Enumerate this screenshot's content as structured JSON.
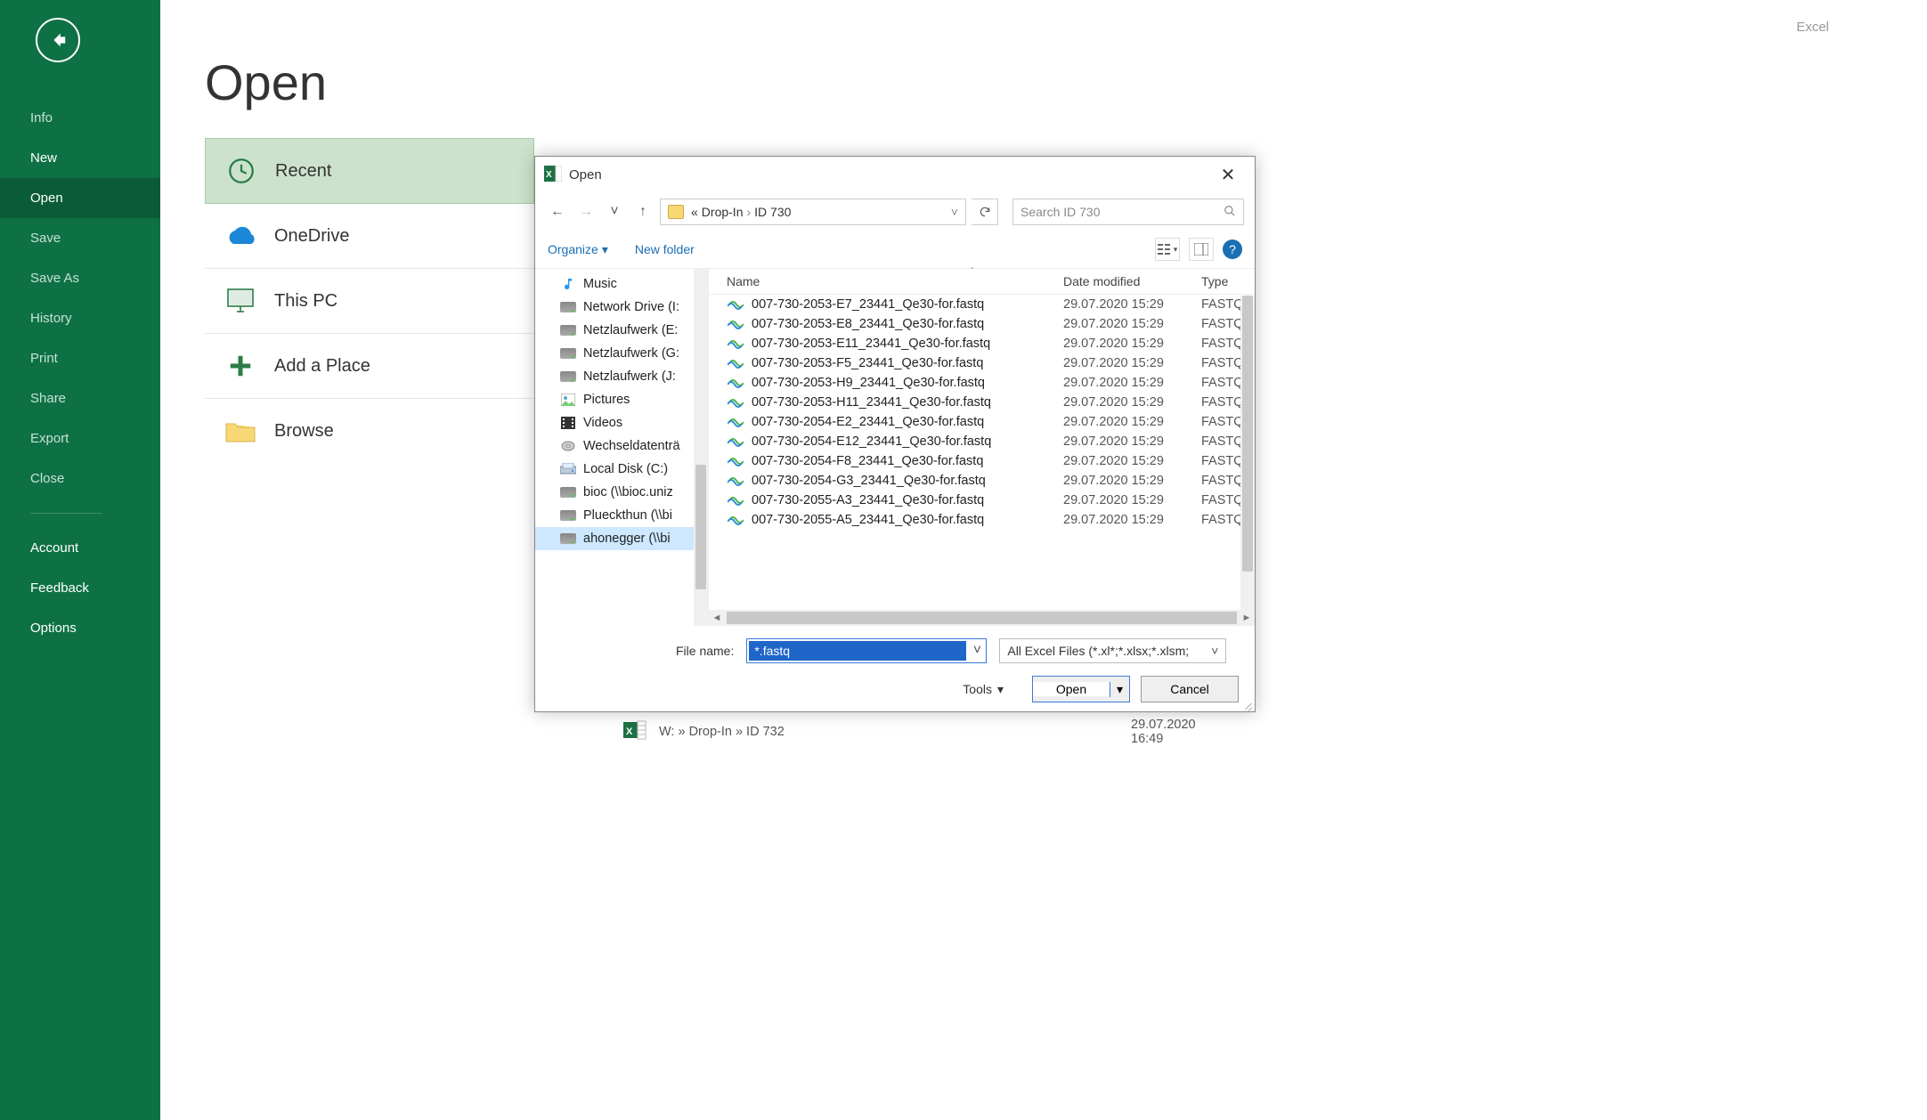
{
  "app_title": "Excel",
  "page_title": "Open",
  "green_nav": {
    "items": [
      {
        "label": "Info",
        "dim": true
      },
      {
        "label": "New",
        "white": true
      },
      {
        "label": "Open",
        "selected": true
      },
      {
        "label": "Save",
        "dim": true
      },
      {
        "label": "Save As",
        "dim": true
      },
      {
        "label": "History",
        "dim": true
      },
      {
        "label": "Print",
        "dim": true
      },
      {
        "label": "Share",
        "dim": true
      },
      {
        "label": "Export",
        "dim": true
      },
      {
        "label": "Close",
        "dim": true
      }
    ],
    "bottom": [
      {
        "label": "Account"
      },
      {
        "label": "Feedback"
      },
      {
        "label": "Options"
      }
    ]
  },
  "places": [
    {
      "label": "Recent",
      "icon": "clock",
      "selected": true
    },
    {
      "label": "OneDrive",
      "icon": "cloud"
    },
    {
      "label": "This PC",
      "icon": "monitor"
    },
    {
      "label": "Add a Place",
      "icon": "plus"
    },
    {
      "label": "Browse",
      "icon": "folder"
    }
  ],
  "dialog": {
    "title": "Open",
    "breadcrumb_prefix": "«",
    "breadcrumbs": [
      "Drop-In",
      "ID 730"
    ],
    "search_placeholder": "Search ID 730",
    "toolbar": {
      "organize": "Organize",
      "newfolder": "New folder"
    },
    "tree": [
      {
        "label": "Music",
        "icon": "music"
      },
      {
        "label": "Network Drive (I:",
        "icon": "drive"
      },
      {
        "label": "Netzlaufwerk (E:",
        "icon": "drive"
      },
      {
        "label": "Netzlaufwerk (G:",
        "icon": "drive"
      },
      {
        "label": "Netzlaufwerk (J:",
        "icon": "drive"
      },
      {
        "label": "Pictures",
        "icon": "picture"
      },
      {
        "label": "Videos",
        "icon": "video"
      },
      {
        "label": "Wechseldatenträ",
        "icon": "disk"
      },
      {
        "label": "Local Disk (C:)",
        "icon": "localdisk"
      },
      {
        "label": "bioc (\\\\bioc.uniz",
        "icon": "drive"
      },
      {
        "label": "Plueckthun (\\\\bi",
        "icon": "drive"
      },
      {
        "label": "ahonegger (\\\\bi",
        "icon": "drive",
        "selected": true
      }
    ],
    "columns": {
      "name": "Name",
      "date": "Date modified",
      "type": "Type"
    },
    "files": [
      {
        "name": "007-730-2053-E7_23441_Qe30-for.fastq",
        "date": "29.07.2020 15:29",
        "type": "FASTQ"
      },
      {
        "name": "007-730-2053-E8_23441_Qe30-for.fastq",
        "date": "29.07.2020 15:29",
        "type": "FASTQ"
      },
      {
        "name": "007-730-2053-E11_23441_Qe30-for.fastq",
        "date": "29.07.2020 15:29",
        "type": "FASTQ"
      },
      {
        "name": "007-730-2053-F5_23441_Qe30-for.fastq",
        "date": "29.07.2020 15:29",
        "type": "FASTQ"
      },
      {
        "name": "007-730-2053-H9_23441_Qe30-for.fastq",
        "date": "29.07.2020 15:29",
        "type": "FASTQ"
      },
      {
        "name": "007-730-2053-H11_23441_Qe30-for.fastq",
        "date": "29.07.2020 15:29",
        "type": "FASTQ"
      },
      {
        "name": "007-730-2054-E2_23441_Qe30-for.fastq",
        "date": "29.07.2020 15:29",
        "type": "FASTQ"
      },
      {
        "name": "007-730-2054-E12_23441_Qe30-for.fastq",
        "date": "29.07.2020 15:29",
        "type": "FASTQ"
      },
      {
        "name": "007-730-2054-F8_23441_Qe30-for.fastq",
        "date": "29.07.2020 15:29",
        "type": "FASTQ"
      },
      {
        "name": "007-730-2054-G3_23441_Qe30-for.fastq",
        "date": "29.07.2020 15:29",
        "type": "FASTQ"
      },
      {
        "name": "007-730-2055-A3_23441_Qe30-for.fastq",
        "date": "29.07.2020 15:29",
        "type": "FASTQ"
      },
      {
        "name": "007-730-2055-A5_23441_Qe30-for.fastq",
        "date": "29.07.2020 15:29",
        "type": "FASTQ"
      }
    ],
    "filename_label": "File name:",
    "filename_value": "*.fastq",
    "filter_label": "All Excel Files (*.xl*;*.xlsx;*.xlsm;",
    "tools_label": "Tools",
    "open_label": "Open",
    "cancel_label": "Cancel"
  },
  "recent_behind": {
    "path": "W: » Drop-In » ID 732",
    "date": "29.07.2020 16:49"
  }
}
